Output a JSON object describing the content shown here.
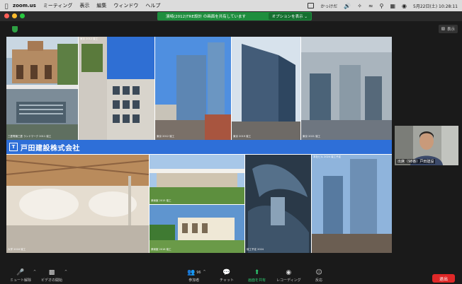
{
  "menubar": {
    "app": "zoom.us",
    "items": [
      "ミーティング",
      "表示",
      "編集",
      "ウィンドウ",
      "ヘルプ"
    ],
    "tray_label": "かっけだ",
    "date_time": "5月22日(土) 10:28:11"
  },
  "titlebar": {
    "share_text": "濱﨑(2012)TRE設計 の画面を共有しています",
    "share_options": "オプションを表示 ⌄"
  },
  "view_button": "表示",
  "slide": {
    "company": "戸田建設株式会社",
    "captions": [
      "三菱電機三菱 ランドマーク 2011 竣工",
      "東京 2012 竣工",
      "東京 2012 竣工",
      "東京 2019 竣工",
      "東京 2021 竣工",
      "大学 2016 竣工",
      "美術館 2015 竣工",
      "美術館 2018 竣工",
      "竣工予定 2024",
      "本社ビル 2024 竣工予定"
    ]
  },
  "participant": {
    "name": "出席（98番）戸田建設"
  },
  "toolbar": {
    "mute": "ミュート解除",
    "video": "ビデオの開始",
    "participants": "参加者",
    "participant_count": "96",
    "chat": "チャット",
    "share": "画面を共有",
    "record": "レコーディング",
    "reactions": "反応",
    "end": "退出"
  },
  "colors": {
    "banner": "#2e6fd8",
    "share_banner": "#1e8e3e",
    "end": "#e02828"
  }
}
